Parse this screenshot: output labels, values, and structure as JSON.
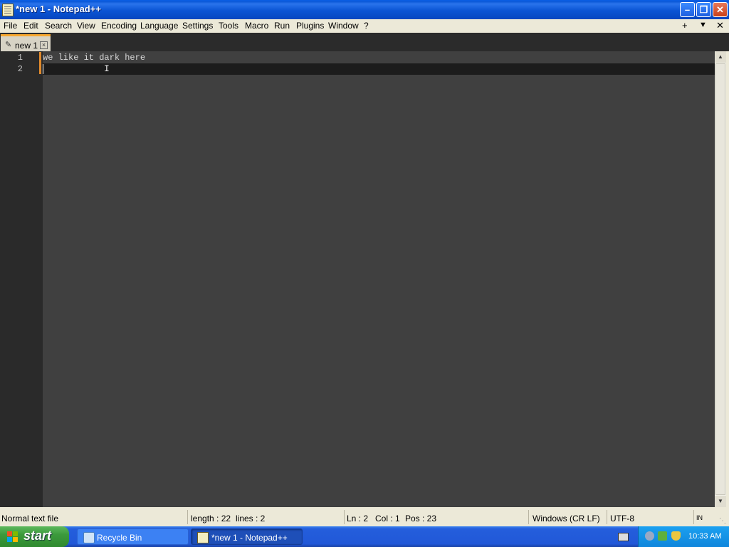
{
  "window": {
    "title": "*new 1 - Notepad++",
    "min_glyph": "–",
    "max_glyph": "❐",
    "close_glyph": "✕"
  },
  "menu": {
    "items": [
      "File",
      "Edit",
      "Search",
      "View",
      "Encoding",
      "Language",
      "Settings",
      "Tools",
      "Macro",
      "Run",
      "Plugins",
      "Window",
      "?"
    ],
    "right_glyphs": [
      "+",
      "▼",
      "✕"
    ]
  },
  "tabs": [
    {
      "name": "new 1",
      "modified": true
    }
  ],
  "editor": {
    "line_numbers": [
      "1",
      "2"
    ],
    "lines": [
      "we like it dark here",
      ""
    ],
    "ibeam_glyph": "I"
  },
  "status": {
    "file_type": "Normal text file",
    "length": "length : 22",
    "lines": "lines : 2",
    "ln": "Ln : 2",
    "col": "Col : 1",
    "pos": "Pos : 23",
    "eol": "Windows (CR LF)",
    "encoding": "UTF-8",
    "mode": "IN"
  },
  "taskbar": {
    "start": "start",
    "tasks": [
      {
        "label": "Recycle Bin",
        "icon": "recycle-bin-icon"
      },
      {
        "label": "*new 1 - Notepad++",
        "icon": "notepad-icon"
      }
    ],
    "clock": "10:33 AM"
  },
  "colors": {
    "editor_bg": "#404040",
    "current_line": "#1c1c1c",
    "gutter_bg": "#2a2a2a",
    "tab_accent": "#f7a830"
  }
}
